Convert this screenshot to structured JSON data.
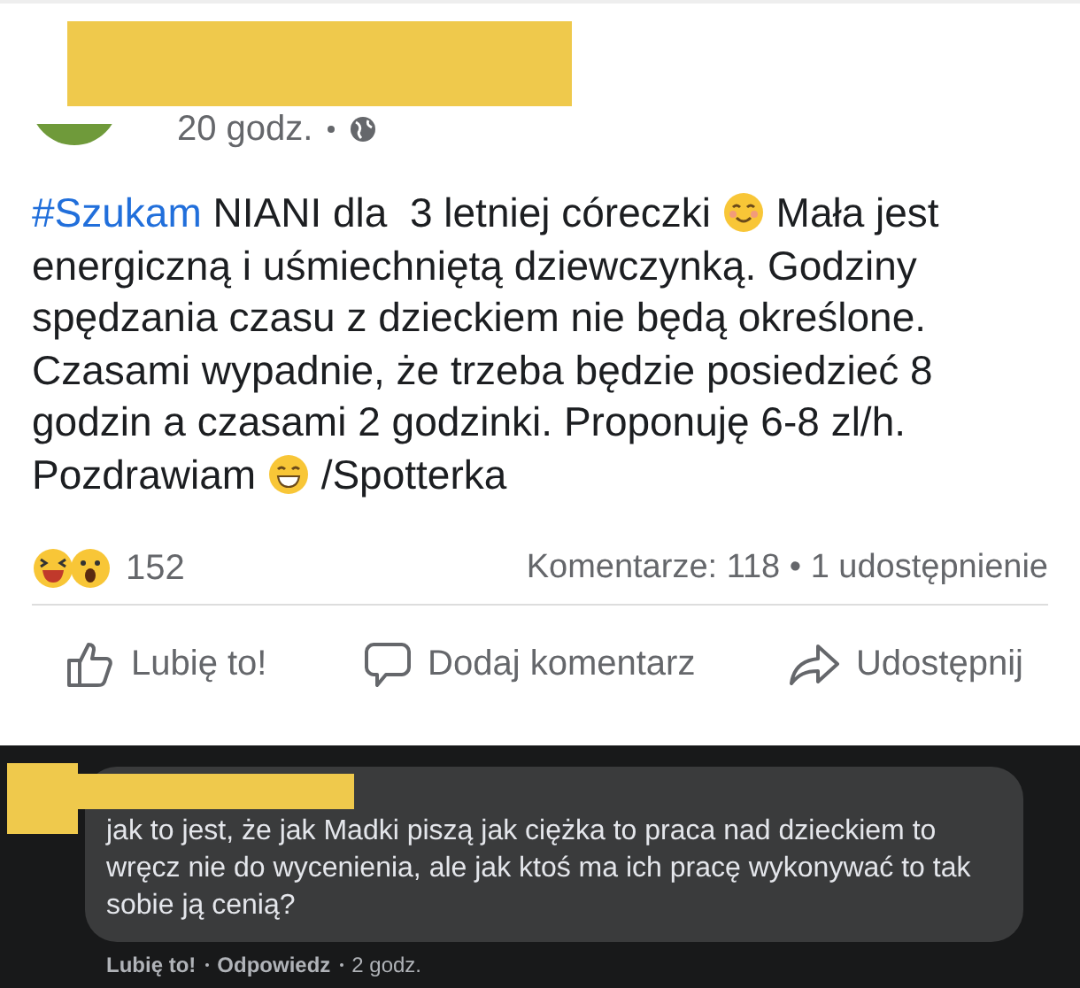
{
  "post": {
    "time": "20 godz.",
    "body": [
      {
        "kind": "hashtag",
        "text": "#Szukam"
      },
      {
        "kind": "text",
        "text": " NIANI dla  3 letniej córeczki "
      },
      {
        "kind": "smile"
      },
      {
        "kind": "text",
        "text": " Mała jest energiczną i uśmiechniętą dziewczynką. Godziny spędzania czasu z dzieckiem nie będą określone.  Czasami wypadnie, że trzeba będzie posiedzieć 8 godzin a czasami 2 godzinki. Proponuję 6-8 zl/h. Pozdrawiam "
      },
      {
        "kind": "grin"
      },
      {
        "kind": "text",
        "text": " /Spotterka"
      }
    ],
    "reactions": {
      "count": "152"
    },
    "stats": "Komentarze: 118 • 1 udostępnienie",
    "actions": [
      {
        "kind": "like",
        "label": "Lubię to!"
      },
      {
        "kind": "comment",
        "label": "Dodaj komentarz"
      },
      {
        "kind": "share",
        "label": "Udostępnij"
      }
    ]
  },
  "comment": {
    "text": "jak to jest, że jak Madki piszą jak ciężka to praca nad dzieckiem to wręcz nie do wycenienia, ale jak ktoś ma ich pracę wykonywać to tak sobie ją cenią?",
    "links": [
      "Lubię to!",
      "Odpowiedz"
    ],
    "time": "2 godz."
  }
}
